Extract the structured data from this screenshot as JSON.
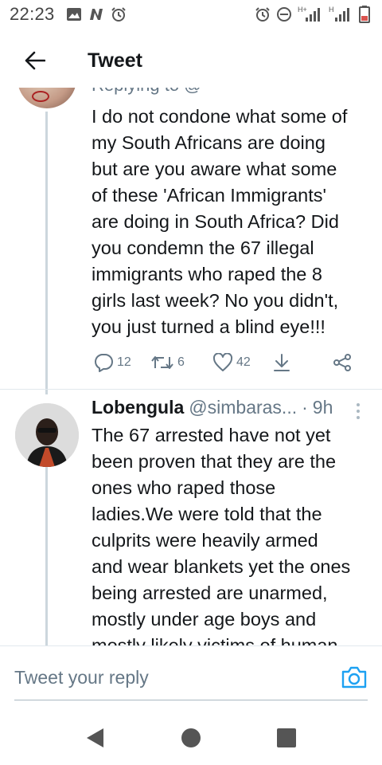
{
  "status_bar": {
    "time": "22:23",
    "network_label_1": "H+",
    "network_label_2": "H"
  },
  "header": {
    "title": "Tweet"
  },
  "thread": {
    "cutoff_text": "Replying to @",
    "tweet1": {
      "lines": [
        "I do not condone what some of",
        "my South Africans are doing",
        "but are you aware what some",
        "of these 'African Immigrants'",
        "are doing in South Africa? Did",
        "you condemn the 67 illegal",
        "immigrants who raped the 8",
        "girls last week? No you didn't,",
        "you just turned a blind eye!!!"
      ],
      "actions": {
        "replies": "12",
        "retweets": "6",
        "likes": "42"
      }
    },
    "tweet2": {
      "name": "Lobengula",
      "handle": "@simbaras...",
      "separator": "·",
      "time": "9h",
      "lines": [
        "The 67 arrested have not yet",
        "been proven that they are the",
        "ones who raped those",
        "ladies.We were told that the",
        "culprits were heavily armed",
        "and wear blankets yet the ones",
        "being arrested are unarmed,",
        "mostly under age boys and",
        "mostly likely victims of human"
      ]
    }
  },
  "reply_bar": {
    "placeholder": "Tweet your reply"
  },
  "colors": {
    "accent": "#1da1f2",
    "text": "#14171a",
    "muted": "#657786",
    "thread_line": "#ccd6dd"
  }
}
